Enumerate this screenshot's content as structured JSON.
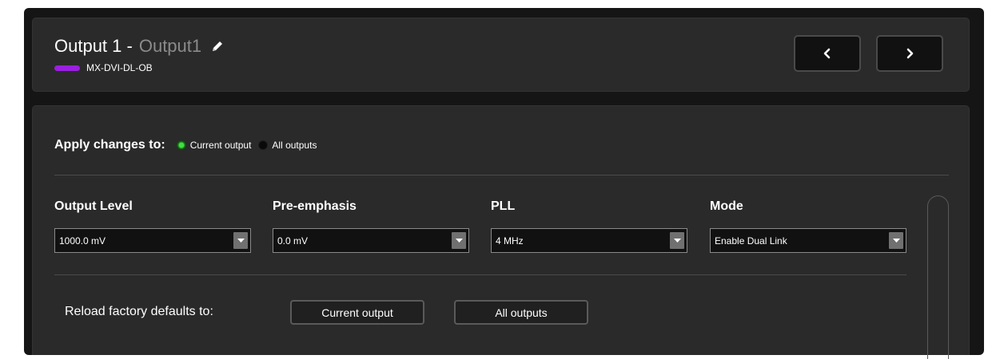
{
  "header": {
    "title_prefix": "Output 1 -",
    "output_name": "Output1",
    "edit_icon": "pencil-icon",
    "device_name": "MX-DVI-DL-OB",
    "device_color": "#9b1fe0",
    "prev_icon": "chevron-left-icon",
    "next_icon": "chevron-right-icon"
  },
  "apply": {
    "label": "Apply changes to:",
    "options": [
      {
        "label": "Current output",
        "selected": true
      },
      {
        "label": "All outputs",
        "selected": false
      }
    ]
  },
  "fields": [
    {
      "label": "Output Level",
      "value": "1000.0 mV"
    },
    {
      "label": "Pre-emphasis",
      "value": "0.0 mV"
    },
    {
      "label": "PLL",
      "value": "4 MHz"
    },
    {
      "label": "Mode",
      "value": "Enable Dual Link"
    }
  ],
  "reload": {
    "label": "Reload factory defaults to:",
    "current_button": "Current output",
    "all_button": "All outputs"
  },
  "colors": {
    "radio_selected": "#3fe03f",
    "panel": "#2a2a2a",
    "background": "#151515"
  }
}
